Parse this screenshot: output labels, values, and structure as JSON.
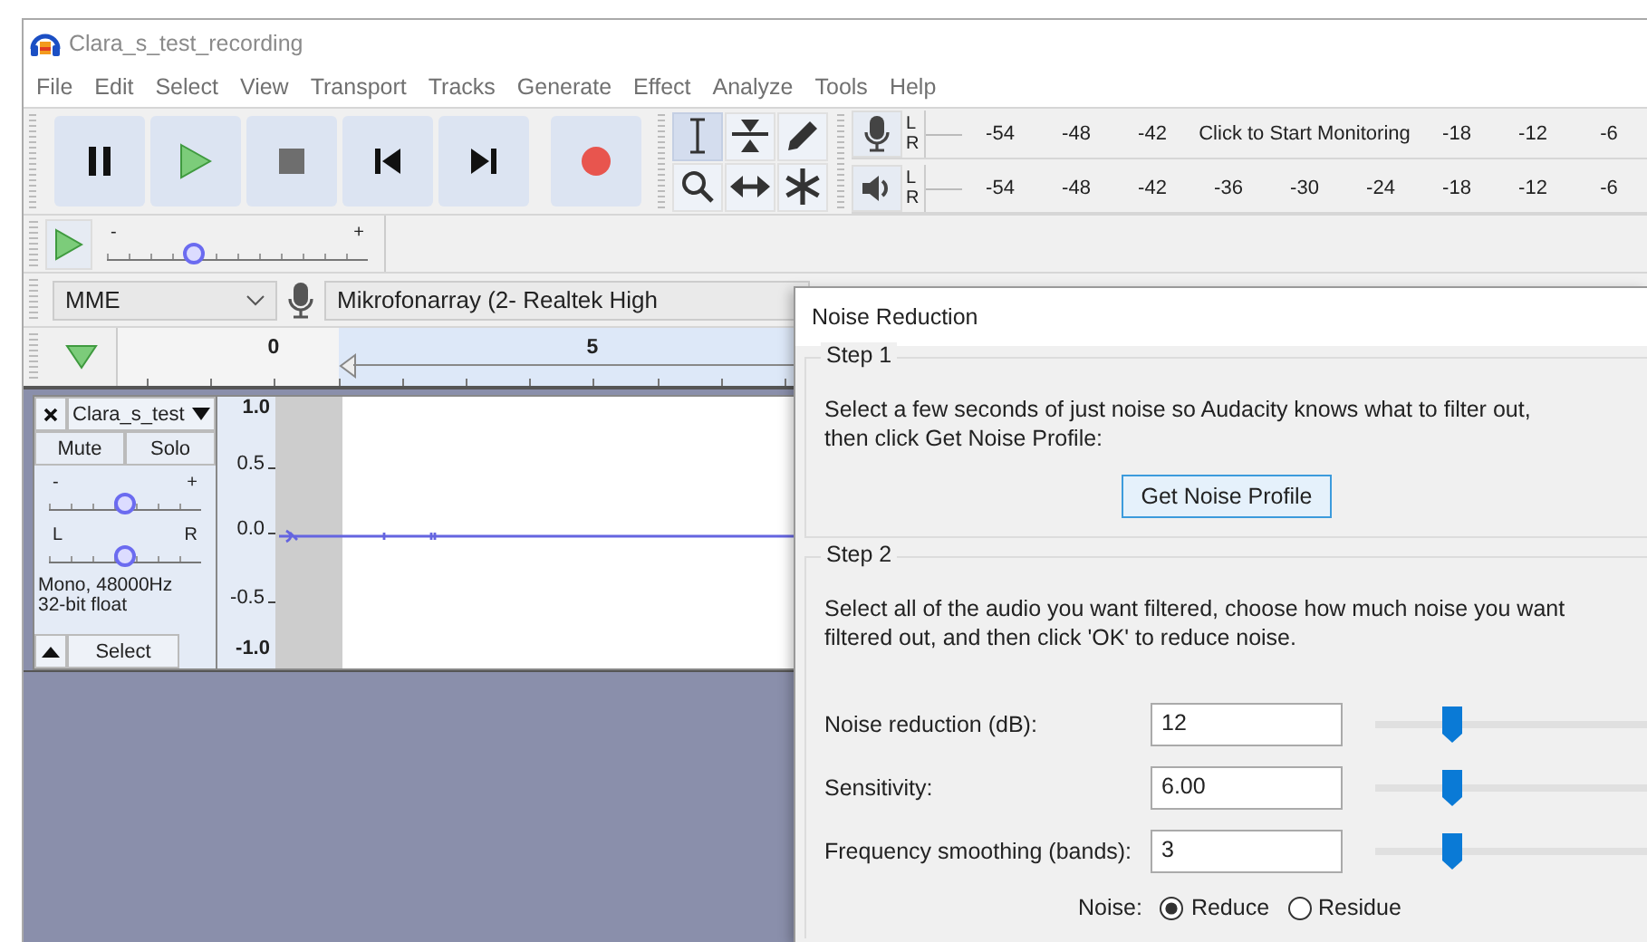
{
  "window": {
    "title": "Clara_s_test_recording"
  },
  "menu": [
    "File",
    "Edit",
    "Select",
    "View",
    "Transport",
    "Tracks",
    "Generate",
    "Effect",
    "Analyze",
    "Tools",
    "Help"
  ],
  "transport": [
    {
      "kind": "pause"
    },
    {
      "kind": "play"
    },
    {
      "kind": "stop"
    },
    {
      "kind": "skip-start"
    },
    {
      "kind": "skip-end"
    },
    {
      "kind": "record"
    }
  ],
  "tools": [
    {
      "kind": "select",
      "selected": true
    },
    {
      "kind": "envelope",
      "selected": false
    },
    {
      "kind": "draw",
      "selected": false
    },
    {
      "kind": "zoom",
      "selected": false
    },
    {
      "kind": "time-shift",
      "selected": false
    },
    {
      "kind": "multi",
      "selected": false
    }
  ],
  "meters": [
    {
      "kind": "record",
      "channels": [
        "L",
        "R"
      ],
      "ticks_before": [
        "-54",
        "-48",
        "-42"
      ],
      "prompt": "Click to Start Monitoring",
      "ticks_after": [
        "-18",
        "-12",
        "-6"
      ]
    },
    {
      "kind": "playback",
      "channels": [
        "L",
        "R"
      ],
      "ticks_before": [
        "-54",
        "-48",
        "-42",
        "-36",
        "-30",
        "-24",
        "-18",
        "-12",
        "-6"
      ]
    }
  ],
  "play_at_speed": {
    "minus": "-",
    "plus": "+",
    "level": 0.33
  },
  "device": {
    "host": "MME",
    "input": "Mikrofonarray (2- Realtek High"
  },
  "timeline": {
    "labels": [
      "0",
      "5"
    ]
  },
  "track": {
    "name": "Clara_s_test",
    "mute": "Mute",
    "solo": "Solo",
    "gain": {
      "minus": "-",
      "plus": "+",
      "level": 0.5
    },
    "pan": {
      "left": "L",
      "right": "R",
      "level": 0.5
    },
    "info": "Mono, 48000Hz\n32-bit float",
    "select": "Select",
    "scale": [
      "1.0",
      "0.5",
      "0.0",
      "-0.5",
      "-1.0"
    ]
  },
  "dialog": {
    "title": "Noise Reduction",
    "step1": {
      "title": "Step 1",
      "text": "Select a few seconds of just noise so Audacity knows what to filter out,\nthen click Get Noise Profile:",
      "button": "Get Noise Profile"
    },
    "step2": {
      "title": "Step 2",
      "text": "Select all of the audio you want filtered, choose how much noise you want\nfiltered out, and then click 'OK' to reduce noise.",
      "fields": [
        {
          "label": "Noise reduction (dB):",
          "value": "12",
          "level": 0.28
        },
        {
          "label": "Sensitivity:",
          "value": "6.00",
          "level": 0.28
        },
        {
          "label": "Frequency smoothing (bands):",
          "value": "3",
          "level": 0.28
        }
      ],
      "noise": {
        "label": "Noise:",
        "options": [
          {
            "label": "Reduce",
            "selected": true
          },
          {
            "label": "Residue",
            "selected": false
          }
        ]
      }
    }
  }
}
